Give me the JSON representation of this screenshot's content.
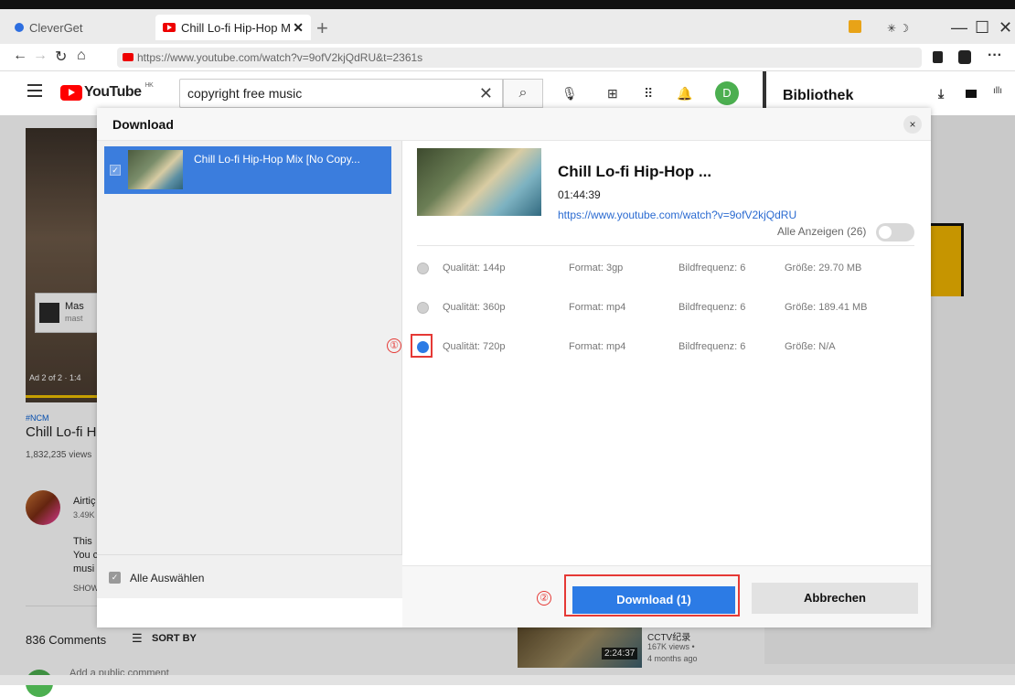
{
  "browser": {
    "tabs": [
      {
        "label": "CleverGet",
        "active": false
      },
      {
        "label": "Chill Lo-fi Hip-Hop M",
        "active": true
      }
    ],
    "close_glyph": "✕",
    "new_tab_glyph": "+",
    "url": "https://www.youtube.com/watch?v=9ofV2kjQdRU&t=2361s",
    "window_controls": [
      "—",
      "☐",
      "✕"
    ],
    "more_glyph": "···"
  },
  "youtube": {
    "logo_text": "YouTube",
    "region": "HK",
    "search_value": "copyright free music",
    "clear_glyph": "✕",
    "avatar_letter": "D",
    "library_title": "Bibliothek"
  },
  "background": {
    "ad_name": "Mas",
    "ad_sub": "mast",
    "ad_label": "Ad 2 of 2 · 1:4",
    "hashtag": "#NCM",
    "video_title": "Chill Lo-fi Hi",
    "views": "1,832,235 views",
    "channel_name": "Airtiç",
    "subs": "3.49K",
    "desc_lines": [
      "This",
      "You c",
      "musi"
    ],
    "show_more": "SHOW",
    "comments_count": "836 Comments",
    "sort_label": "SORT BY",
    "add_comment": "Add a public comment",
    "rec_channel": "CCTV纪录",
    "rec_views": "167K views •",
    "rec_age": "4 months ago",
    "rec_duration": "2:24:37"
  },
  "modal": {
    "title": "Download",
    "close_glyph": "×",
    "list_items": [
      {
        "title": "Chill Lo-fi Hip-Hop Mix [No Copy...",
        "selected": true
      }
    ],
    "select_all_label": "Alle Auswählen",
    "detail": {
      "title": "Chill Lo-fi Hip-Hop ...",
      "duration": "01:44:39",
      "url": "https://www.youtube.com/watch?v=9ofV2kjQdRU",
      "show_all_label": "Alle Anzeigen (26)"
    },
    "qualities": [
      {
        "quality": "Qualität: 144p",
        "format": "Format: 3gp",
        "fps": "Bildfrequenz: 6",
        "size": "Größe: 29.70 MB",
        "selected": false
      },
      {
        "quality": "Qualität: 360p",
        "format": "Format: mp4",
        "fps": "Bildfrequenz: 6",
        "size": "Größe: 189.41 MB",
        "selected": false
      },
      {
        "quality": "Qualität: 720p",
        "format": "Format: mp4",
        "fps": "Bildfrequenz: 6",
        "size": "Größe: N/A",
        "selected": true
      }
    ],
    "markers": [
      "①",
      "②"
    ],
    "download_label": "Download (1)",
    "cancel_label": "Abbrechen"
  },
  "colors": {
    "accent": "#2c7be5",
    "marker_red": "#e53935",
    "yt_red": "#ff0000"
  }
}
